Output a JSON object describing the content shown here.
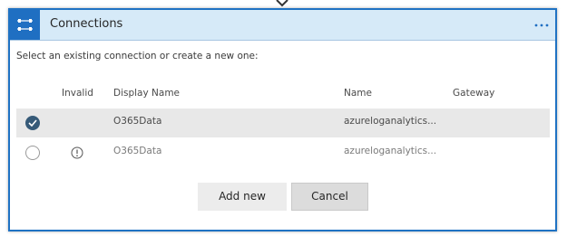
{
  "header": {
    "title": "Connections",
    "more_icon": "ellipsis-icon",
    "leading_icon": "connections-icon"
  },
  "instructions": "Select an existing connection or create a new one:",
  "table": {
    "columns": {
      "invalid": "Invalid",
      "display_name": "Display Name",
      "name": "Name",
      "gateway": "Gateway"
    },
    "rows": [
      {
        "selected": true,
        "invalid": false,
        "display_name": "O365Data",
        "name": "azureloganalytics...",
        "gateway": ""
      },
      {
        "selected": false,
        "invalid": true,
        "display_name": "O365Data",
        "name": "azureloganalytics...",
        "gateway": ""
      }
    ]
  },
  "buttons": {
    "add_new": "Add new",
    "cancel": "Cancel"
  },
  "colors": {
    "accent": "#1f6fc2",
    "header_bg": "#d6eaf8",
    "selected_row_bg": "#e8e8e8",
    "checked_radio": "#365a78"
  }
}
